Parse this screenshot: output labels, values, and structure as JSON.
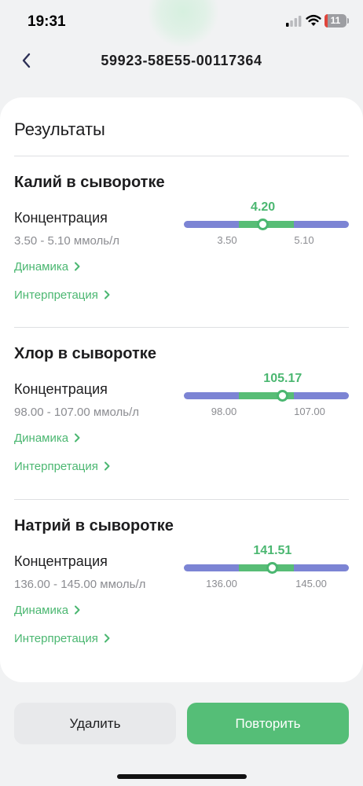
{
  "status_bar": {
    "time": "19:31",
    "battery": "11"
  },
  "header": {
    "title": "59923-58E55-00117364"
  },
  "results": {
    "title": "Результаты",
    "items": [
      {
        "name": "Калий в сыворотке",
        "param": "Концентрация",
        "reference": "3.50 - 5.10 ммоль/л",
        "value": "4.20",
        "value_num": 4.2,
        "low": "3.50",
        "low_num": 3.5,
        "high": "5.10",
        "high_num": 5.1,
        "dynamics_label": "Динамика",
        "interpretation_label": "Интерпретация"
      },
      {
        "name": "Хлор в сыворотке",
        "param": "Концентрация",
        "reference": "98.00 - 107.00 ммоль/л",
        "value": "105.17",
        "value_num": 105.17,
        "low": "98.00",
        "low_num": 98.0,
        "high": "107.00",
        "high_num": 107.0,
        "dynamics_label": "Динамика",
        "interpretation_label": "Интерпретация"
      },
      {
        "name": "Натрий в сыворотке",
        "param": "Концентрация",
        "reference": "136.00 - 145.00 ммоль/л",
        "value": "141.51",
        "value_num": 141.51,
        "low": "136.00",
        "low_num": 136.0,
        "high": "145.00",
        "high_num": 145.0,
        "dynamics_label": "Динамика",
        "interpretation_label": "Интерпретация"
      }
    ]
  },
  "actions": {
    "delete_label": "Удалить",
    "repeat_label": "Повторить"
  },
  "colors": {
    "accent": "#4bb771",
    "range_outside": "#7c84d4",
    "range_normal": "#58bd76"
  }
}
